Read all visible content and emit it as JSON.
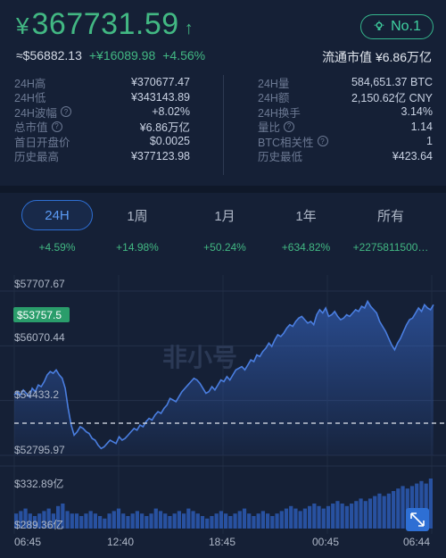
{
  "header": {
    "currency_symbol": "¥",
    "price": "367731.59",
    "arrow": "↑",
    "usd_price": "≈$56882.13",
    "change_abs": "+¥16089.98",
    "change_pct": "+4.56%",
    "rank": "No.1",
    "market_cap_label": "流通市值 ¥6.86万亿"
  },
  "stats_left": [
    {
      "label": "24H高",
      "value": "¥370677.47",
      "help": false
    },
    {
      "label": "24H低",
      "value": "¥343143.89",
      "help": false
    },
    {
      "label": "24H波幅",
      "value": "+8.02%",
      "help": true
    },
    {
      "label": "总市值",
      "value": "¥6.86万亿",
      "help": true
    },
    {
      "label": "首日开盘价",
      "value": "$0.0025",
      "help": false
    },
    {
      "label": "历史最高",
      "value": "¥377123.98",
      "help": false
    }
  ],
  "stats_right": [
    {
      "label": "24H量",
      "value": "584,651.37 BTC",
      "help": false
    },
    {
      "label": "24H额",
      "value": "2,150.62亿 CNY",
      "help": false
    },
    {
      "label": "24H换手",
      "value": "3.14%",
      "help": false
    },
    {
      "label": "量比",
      "value": "1.14",
      "help": true
    },
    {
      "label": "BTC相关性",
      "value": "1",
      "help": true
    },
    {
      "label": "历史最低",
      "value": "¥423.64",
      "help": false
    }
  ],
  "tabs": [
    {
      "label": "24H",
      "change": "+4.59%",
      "active": true
    },
    {
      "label": "1周",
      "change": "+14.98%",
      "active": false
    },
    {
      "label": "1月",
      "change": "+50.24%",
      "active": false
    },
    {
      "label": "1年",
      "change": "+634.82%",
      "active": false
    },
    {
      "label": "所有",
      "change": "+2275811500…",
      "active": false
    }
  ],
  "colors": {
    "up": "#42b883",
    "accent": "#2e6fd4",
    "line": "#4a7ee0",
    "bg": "#152036"
  },
  "watermark": "非小号",
  "chart_data": {
    "type": "line",
    "y_labels": [
      "$57707.67",
      "$56070.44",
      "$54433.2",
      "$52795.97"
    ],
    "ylim": [
      52795.97,
      57707.67
    ],
    "current_price": 53757.5,
    "current_price_label": "$53757.5",
    "x_labels": [
      "06:45",
      "12:40",
      "18:45",
      "00:45",
      "06:44"
    ],
    "volume_labels": [
      "$332.89亿",
      "$289.36亿"
    ],
    "series": [
      {
        "values": [
          54600,
          54700,
          54600,
          54750,
          54650,
          54550,
          54800,
          54700,
          54900,
          54850,
          55000,
          55200,
          55300,
          55250,
          55350,
          55200,
          55100,
          54800,
          54200,
          53700,
          53400,
          53500,
          53650,
          53600,
          53500,
          53450,
          53300,
          53250,
          53100,
          53000,
          53050,
          53150,
          53250,
          53200,
          53150,
          53350,
          53250,
          53300,
          53400,
          53500,
          53600,
          53550,
          53700,
          53650,
          53800,
          53900,
          53850,
          54000,
          54100,
          54050,
          54200,
          54300,
          54500,
          54450,
          54400,
          54550,
          54700,
          54800,
          54900,
          55000,
          55100,
          55050,
          54950,
          54800,
          54650,
          54700,
          54850,
          54750,
          54900,
          55050,
          55000,
          55150,
          55050,
          55200,
          55350,
          55400,
          55450,
          55350,
          55500,
          55650,
          55600,
          55800,
          55750,
          55900,
          56000,
          56150,
          56050,
          56250,
          56400,
          56350,
          56450,
          56600,
          56700,
          56650,
          56800,
          56900,
          56950,
          56850,
          56750,
          56800,
          56700,
          57000,
          57150,
          57050,
          57200,
          56950,
          57000,
          57100,
          56950,
          56850,
          56900,
          57000,
          56950,
          57050,
          57150,
          57100,
          57250,
          57200,
          57400,
          57250,
          57150,
          57050,
          56800,
          56650,
          56500,
          56300,
          56100,
          55950,
          56150,
          56300,
          56500,
          56700,
          56850,
          56900,
          57050,
          57200,
          57100,
          57300,
          57200,
          57150,
          57300
        ]
      }
    ],
    "volume_values": [
      0.3,
      0.35,
      0.4,
      0.3,
      0.25,
      0.3,
      0.35,
      0.4,
      0.3,
      0.45,
      0.5,
      0.35,
      0.3,
      0.3,
      0.25,
      0.3,
      0.35,
      0.3,
      0.25,
      0.2,
      0.3,
      0.35,
      0.4,
      0.3,
      0.25,
      0.3,
      0.35,
      0.3,
      0.25,
      0.3,
      0.4,
      0.35,
      0.3,
      0.25,
      0.3,
      0.35,
      0.3,
      0.4,
      0.35,
      0.3,
      0.25,
      0.2,
      0.25,
      0.3,
      0.35,
      0.3,
      0.25,
      0.3,
      0.35,
      0.4,
      0.3,
      0.25,
      0.3,
      0.35,
      0.3,
      0.25,
      0.3,
      0.35,
      0.4,
      0.45,
      0.4,
      0.35,
      0.4,
      0.45,
      0.5,
      0.45,
      0.4,
      0.45,
      0.5,
      0.55,
      0.5,
      0.45,
      0.5,
      0.55,
      0.6,
      0.55,
      0.6,
      0.65,
      0.7,
      0.65,
      0.7,
      0.75,
      0.8,
      0.85,
      0.8,
      0.85,
      0.9,
      0.95,
      0.9,
      1.0
    ]
  }
}
